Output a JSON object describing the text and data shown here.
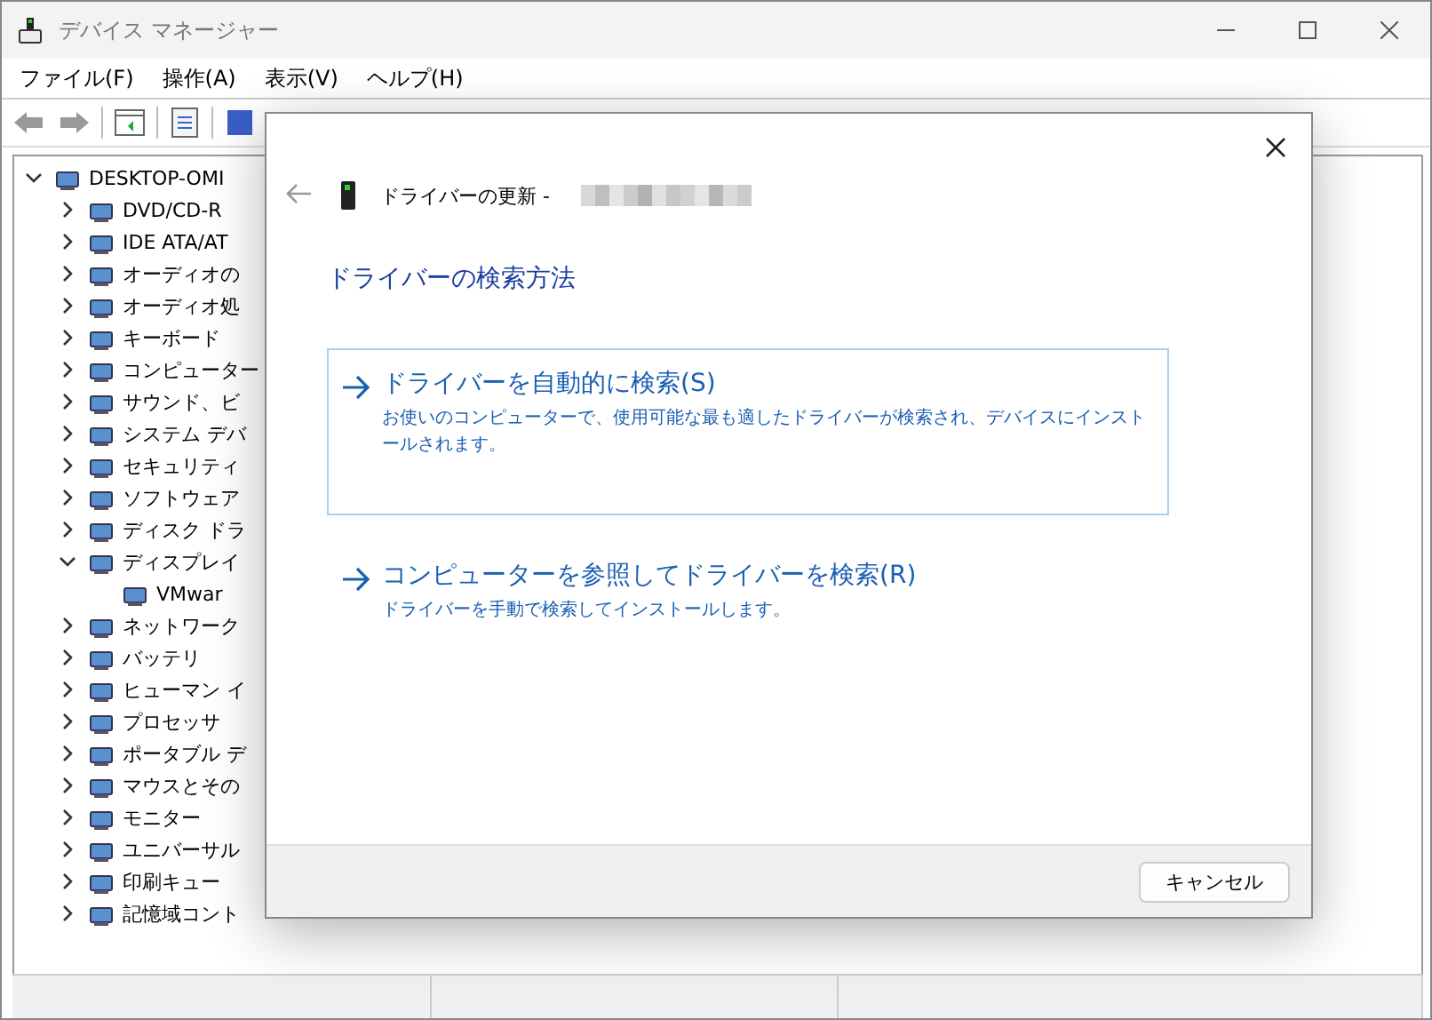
{
  "window": {
    "title": "デバイス マネージャー"
  },
  "menu": [
    "ファイル(F)",
    "操作(A)",
    "表示(V)",
    "ヘルプ(H)"
  ],
  "tree": [
    {
      "label": "DESKTOP-OMI",
      "expanded": true,
      "children": [
        {
          "label": "DVD/CD-R",
          "expanded": false
        },
        {
          "label": "IDE ATA/AT",
          "expanded": false
        },
        {
          "label": "オーディオの",
          "expanded": false
        },
        {
          "label": "オーディオ処",
          "expanded": false
        },
        {
          "label": "キーボード",
          "expanded": false
        },
        {
          "label": "コンピューター",
          "expanded": false
        },
        {
          "label": "サウンド、ビ",
          "expanded": false
        },
        {
          "label": "システム デバ",
          "expanded": false
        },
        {
          "label": "セキュリティ",
          "expanded": false
        },
        {
          "label": "ソフトウェア",
          "expanded": false
        },
        {
          "label": "ディスク ドラ",
          "expanded": false
        },
        {
          "label": "ディスプレイ",
          "expanded": true,
          "children": [
            {
              "label": "VMwar"
            }
          ]
        },
        {
          "label": "ネットワーク",
          "expanded": false
        },
        {
          "label": "バッテリ",
          "expanded": false
        },
        {
          "label": "ヒューマン イ",
          "expanded": false
        },
        {
          "label": "プロセッサ",
          "expanded": false
        },
        {
          "label": "ポータブル デ",
          "expanded": false
        },
        {
          "label": "マウスとその",
          "expanded": false
        },
        {
          "label": "モニター",
          "expanded": false
        },
        {
          "label": "ユニバーサル",
          "expanded": false
        },
        {
          "label": "印刷キュー",
          "expanded": false
        },
        {
          "label": "記憶域コント",
          "expanded": false
        }
      ]
    }
  ],
  "dialog": {
    "title": "ドライバーの更新 -",
    "heading": "ドライバーの検索方法",
    "options": [
      {
        "title": "ドライバーを自動的に検索(S)",
        "description": "お使いのコンピューターで、使用可能な最も適したドライバーが検索され、デバイスにインストールされます。",
        "focused": true
      },
      {
        "title": "コンピューターを参照してドライバーを検索(R)",
        "description": "ドライバーを手動で検索してインストールします。",
        "focused": false
      }
    ],
    "buttons": [
      "キャンセル"
    ]
  }
}
